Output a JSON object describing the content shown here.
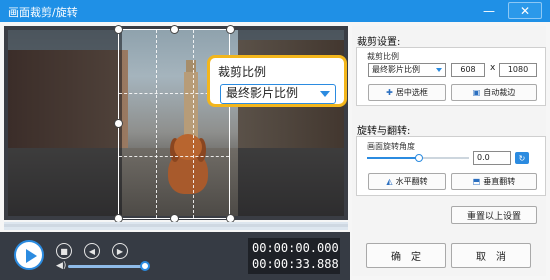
{
  "window": {
    "title": "画面裁剪/旋转",
    "minimize_icon": "minimize-icon",
    "close_icon": "close-icon"
  },
  "callout": {
    "title": "裁剪比例",
    "value": "最终影片比例"
  },
  "player": {
    "time_current": "00:00:00.000",
    "time_total": "00:00:33.888",
    "volume_level": 0.95,
    "timeline_position": 0.0,
    "icons": [
      "play-icon",
      "stop-icon",
      "previous-frame-icon",
      "next-frame-icon",
      "volume-icon"
    ]
  },
  "crop": {
    "section_title": "裁剪设置:",
    "ratio_label": "裁剪比例",
    "ratio_value": "最终影片比例",
    "width": "608",
    "separator": "x",
    "height": "1080",
    "center_button": "居中选框",
    "auto_button": "自动裁边"
  },
  "rotate": {
    "section_title": "旋转与翻转:",
    "angle_label": "画面旋转角度",
    "angle_value": "0.0",
    "angle_slider_fraction": 0.5,
    "hflip_button": "水平翻转",
    "vflip_button": "垂直翻转"
  },
  "reset_button": "重置以上设置",
  "ok_button": "确　定",
  "cancel_button": "取　消",
  "colors": {
    "accent": "#2b8be0",
    "titlebar": "#1f90e6",
    "callout_border": "#f3b61c"
  }
}
